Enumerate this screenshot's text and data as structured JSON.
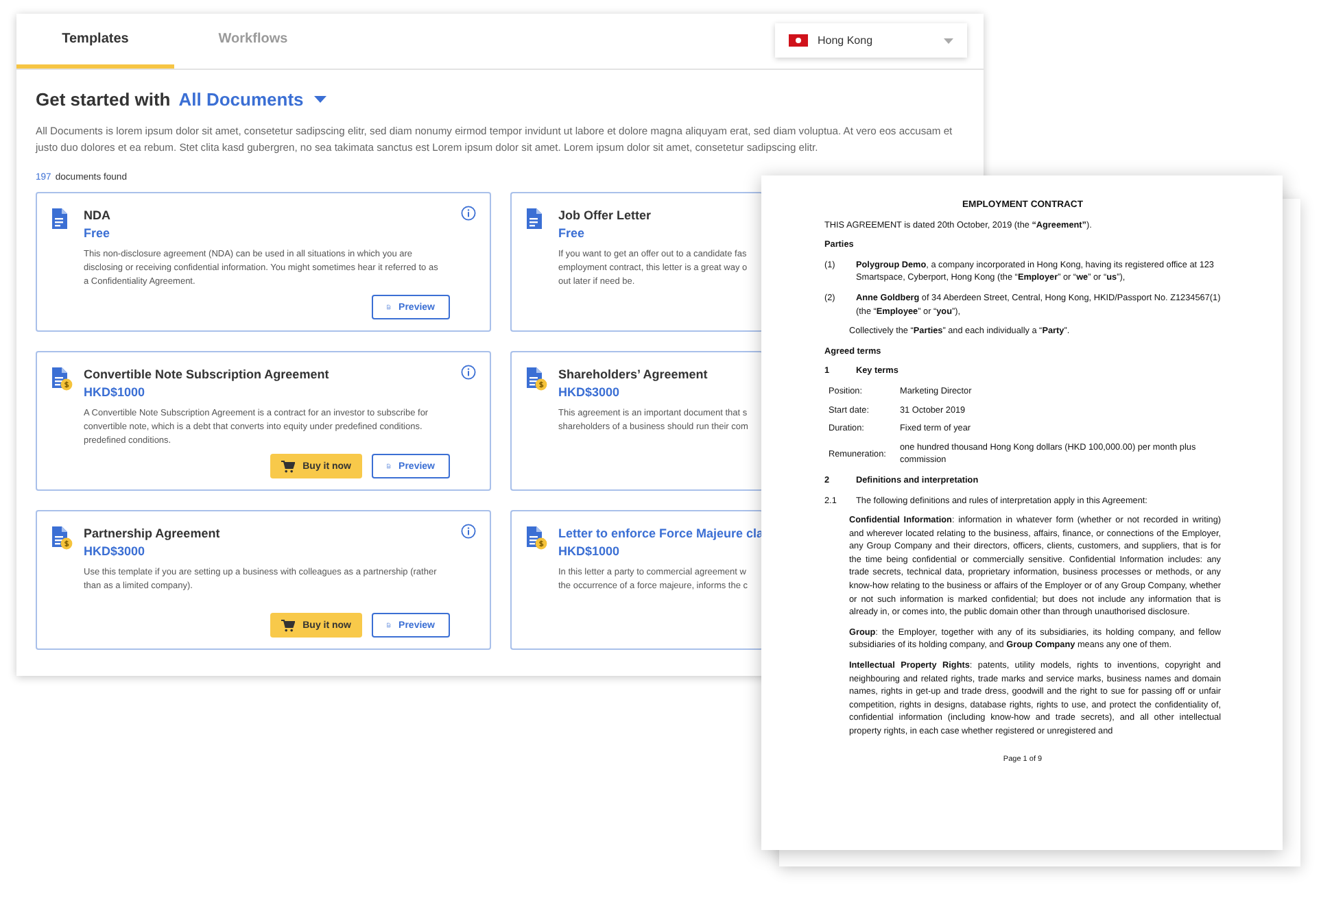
{
  "tabs": [
    {
      "label": "Templates",
      "selected": true
    },
    {
      "label": "Workflows",
      "selected": false
    }
  ],
  "region": {
    "label": "Hong Kong"
  },
  "heading": {
    "prefix": "Get started with",
    "category": "All Documents"
  },
  "intro": "All Documents is lorem ipsum dolor sit amet, consetetur sadipscing elitr, sed diam nonumy eirmod tempor invidunt ut labore et dolore magna aliquyam erat, sed diam voluptua. At vero eos accusam et justo duo dolores et ea rebum. Stet clita kasd gubergren, no sea takimata sanctus est Lorem ipsum dolor sit amet. Lorem ipsum dolor sit amet, consetetur sadipscing elitr.",
  "results": {
    "count": "197",
    "label": "documents found"
  },
  "cards": [
    {
      "kind": "free",
      "title": "NDA",
      "highlighted": false,
      "price": "Free",
      "info": true,
      "description_lines": [
        "This non-disclosure agreement (NDA) can be used in all situations in which you are",
        "disclosing or receiving confidential information. You might sometimes hear it referred to as",
        "a Confidentiality Agreement."
      ],
      "buttons": [
        {
          "kind": "preview",
          "label": "Preview"
        }
      ]
    },
    {
      "kind": "free",
      "title": "Job Offer Letter",
      "highlighted": false,
      "price": "Free",
      "description_lines": [
        "If you want to get an offer out to a candidate fas",
        "employment contract, this letter is a great way o",
        "out later if need be."
      ]
    },
    {
      "kind": "paid",
      "title": "Convertible Note Subscription Agreement",
      "highlighted": false,
      "price": "HKD$1000",
      "info": true,
      "description_lines": [
        "A Convertible Note Subscription Agreement is a contract for an investor to subscribe for",
        "convertible note, which is a debt that converts into equity under predefined conditions.",
        "predefined conditions."
      ],
      "buttons": [
        {
          "kind": "buy",
          "label": "Buy it now"
        },
        {
          "kind": "preview",
          "label": "Preview"
        }
      ]
    },
    {
      "kind": "paid",
      "title": "Shareholders’ Agreement",
      "highlighted": false,
      "price": "HKD$3000",
      "description_lines": [
        "This agreement is an important document that s",
        "shareholders of a business should run their com"
      ]
    },
    {
      "kind": "paid",
      "title": "Partnership Agreement",
      "highlighted": false,
      "price": "HKD$3000",
      "info": true,
      "description_lines": [
        "Use this template if you are setting up a business with colleagues as a partnership (rather",
        "than as a limited company)."
      ],
      "buttons": [
        {
          "kind": "buy",
          "label": "Buy it now"
        },
        {
          "kind": "preview",
          "label": "Preview"
        }
      ]
    },
    {
      "kind": "paid",
      "title": "Letter to enforce Force Majeure cla",
      "highlighted": true,
      "price": "HKD$1000",
      "description_lines": [
        "In this letter a party to commercial agreement w",
        "the occurrence of a force majeure, informs the c"
      ]
    }
  ],
  "document": {
    "title": "EMPLOYMENT CONTRACT",
    "blocks": [
      {
        "kind": "para",
        "text": "THIS AGREEMENT is dated 20th October, 2019 (the **“Agreement”**)."
      },
      {
        "kind": "heading",
        "text": "Parties"
      },
      {
        "kind": "clause",
        "number": "(1)",
        "text": "**Polygroup Demo**, a company incorporated in Hong Kong, having its registered office at 123 Smartspace, Cyberport, Hong Kong (the “**Employer**” or “**we**” or “**us**”),"
      },
      {
        "kind": "clause",
        "number": "(2)",
        "text": "**Anne Goldberg** of 34 Aberdeen Street, Central, Hong Kong, HKID/Passport No. Z1234567(1) (the “**Employee**” or “**you**”),"
      },
      {
        "kind": "indent",
        "text": "Collectively the “**Parties**” and each individually a “**Party**”."
      },
      {
        "kind": "heading",
        "text": "Agreed terms"
      },
      {
        "kind": "section",
        "number": "1",
        "text": "Key terms"
      },
      {
        "kind": "terms",
        "rows": [
          {
            "label": "Position:",
            "value": "Marketing Director"
          },
          {
            "label": "Start date:",
            "value": "31 October 2019"
          },
          {
            "label": "Duration:",
            "value": "Fixed term of  year"
          },
          {
            "label": "Remuneration:",
            "value": "one hundred thousand Hong Kong dollars (HKD 100,000.00) per month plus commission"
          }
        ]
      },
      {
        "kind": "section",
        "number": "2",
        "text": "Definitions and interpretation"
      },
      {
        "kind": "clause",
        "number": "2.1",
        "text": "The following definitions and rules of interpretation apply in this Agreement:"
      },
      {
        "kind": "indent",
        "text": "**Confidential Information**: information in whatever form (whether or not recorded in writing) and wherever located relating to the business, affairs, finance, or connections of the Employer, any Group Company and their directors, officers, clients, customers, and suppliers, that is for the time being confidential or commercially sensitive. Confidential Information includes: any trade secrets, technical data, proprietary information, business processes or methods, or any know-how relating to the business or affairs of the Employer or of any Group Company, whether or not such information is marked confidential; but does not include any information that is already in, or comes into, the public domain other than through unauthorised disclosure."
      },
      {
        "kind": "indent",
        "text": "**Group**: the Employer, together with any of its subsidiaries, its holding company, and fellow subsidiaries of its holding company, and **Group Company** means any one of them."
      },
      {
        "kind": "indent",
        "text": "**Intellectual Property Rights**: patents, utility models, rights to inventions, copyright and neighbouring and related rights, trade marks and service marks, business names and domain names, rights in get-up and trade dress, goodwill and the right to sue for passing off or unfair competition, rights in designs, database rights, rights to use, and protect the confidentiality of, confidential information (including know-how and trade secrets), and all other intellectual property rights, in each case whether registered or unregistered and"
      }
    ],
    "footer": "Page 1 of 9"
  }
}
